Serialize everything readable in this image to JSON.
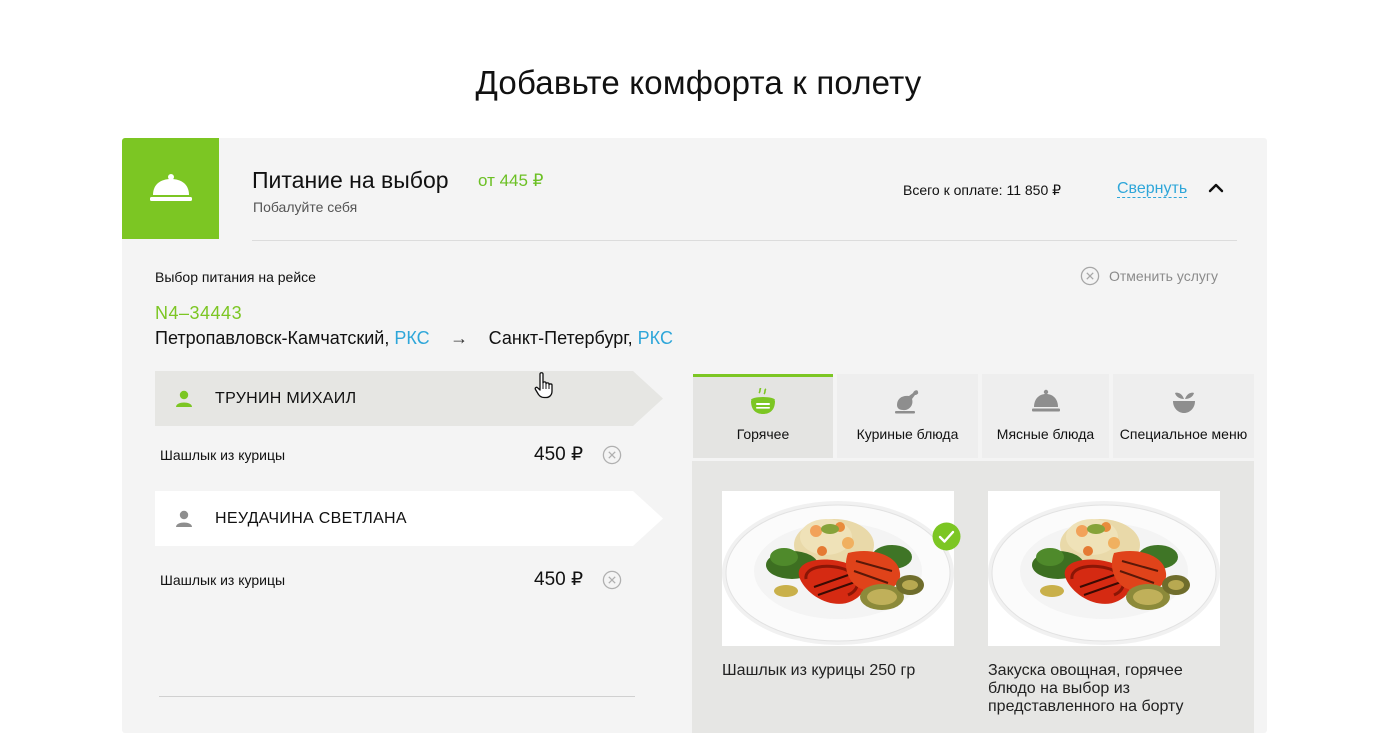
{
  "page": {
    "title": "Добавьте комфорта к полету"
  },
  "service": {
    "icon": "cloche-icon",
    "title": "Питание на выбор",
    "price_from": "от 445 ₽",
    "subtitle": "Побалуйте себя",
    "total_text": "Всего к оплате: 11 850 ₽",
    "collapse_label": "Свернуть",
    "accent_color": "#7cc623",
    "link_color": "#2ea6d9"
  },
  "selection": {
    "label": "Выбор питания на рейсе",
    "cancel_label": "Отменить услугу",
    "flight_number": "N4–34443",
    "from_city": "Петропавловск-Камчатский, ",
    "from_code": "РКС",
    "arrow": "→",
    "to_city": "Санкт-Петербург, ",
    "to_code": "РКС"
  },
  "passengers": [
    {
      "name": "ТРУНИН МИХАИЛ",
      "active": true,
      "meal": "Шашлык из курицы",
      "price": "450 ₽"
    },
    {
      "name": "НЕУДАЧИНА СВЕТЛАНА",
      "active": false,
      "meal": "Шашлык из курицы",
      "price": "450 ₽"
    }
  ],
  "tabs": [
    {
      "label": "Горячее",
      "icon": "hot-bowl-icon",
      "active": true
    },
    {
      "label": "Куриные блюда",
      "icon": "chicken-icon",
      "active": false
    },
    {
      "label": "Мясные блюда",
      "icon": "cloche-icon",
      "active": false
    },
    {
      "label": "Специальное  меню",
      "icon": "vegetables-icon",
      "active": false
    }
  ],
  "dishes": [
    {
      "name": "Шашлык из курицы 250 гр",
      "selected": true,
      "image": "grilled-vegetables-plate"
    },
    {
      "name": "Закуска овощная, горячее блюдо на выбор из представленного на борту",
      "selected": false,
      "image": "grilled-vegetables-plate"
    }
  ]
}
